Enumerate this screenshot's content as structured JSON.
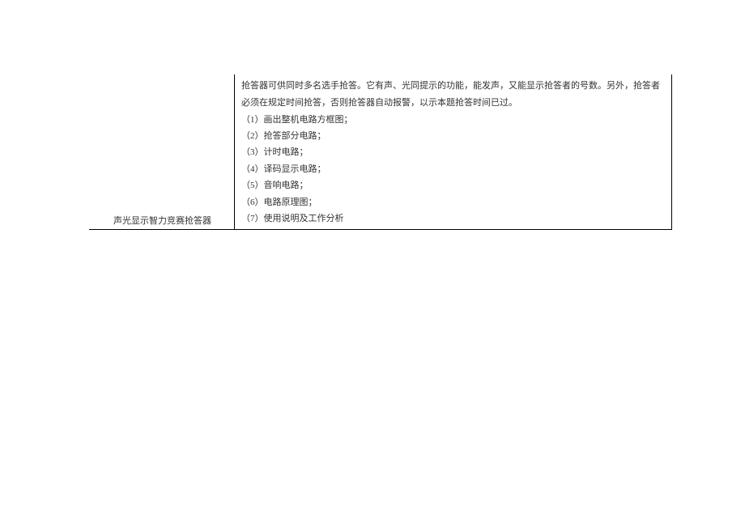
{
  "table": {
    "title": "声光显示智力竞赛抢答器",
    "intro": "抢答器可供同时多名选手抢答。它有声、光同提示的功能，能发声，又能显示抢答者的号数。另外，抢答者必须在规定时间抢答，否则抢答器自动报警，以示本题抢答时间已过。",
    "items": [
      "（1）画出整机电路方框图；",
      "（2）抢答部分电路；",
      "（3）计时电路；",
      "（4）译码显示电路；",
      "（5）音响电路；",
      "（6）电路原理图；",
      "（7）使用说明及工作分析"
    ]
  }
}
